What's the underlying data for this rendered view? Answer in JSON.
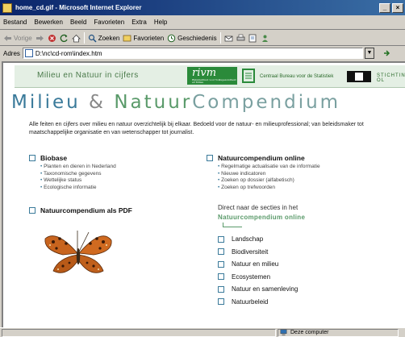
{
  "window": {
    "title": "home_cd.gif - Microsoft Internet Explorer",
    "minimize": "_",
    "close": "×"
  },
  "menu": [
    "Bestand",
    "Bewerken",
    "Beeld",
    "Favorieten",
    "Extra",
    "Help"
  ],
  "toolbar": {
    "back": "Vorige",
    "search": "Zoeken",
    "favorites": "Favorieten",
    "history": "Geschiedenis"
  },
  "address": {
    "label": "Adres",
    "value": "D:\\nc\\cd-rom\\index.htm"
  },
  "page": {
    "tagline": "Milieu en Natuur in cijfers",
    "rivm": "rivm",
    "rivm_small": "Rijksinstituut voor Volksgezondheid en Milieu",
    "cbs": "Centraal Bureau voor de Statistiek",
    "stichting": "STICHTING OL",
    "title_part1": "Milieu",
    "title_amp": " & ",
    "title_part2": "Natuur",
    "title_part3": "Compendium",
    "intro": "Alle feiten en cijfers over milieu en natuur overzichtelijk bij elkaar. Bedoeld voor de natuur- en milieuprofessional; van beleidsmaker tot maatschappelijke organisatie en van wetenschapper tot journalist.",
    "biobase": {
      "title": "Biobase",
      "items": [
        "Planten en dieren in Nederland",
        "Taxonomische gegevens",
        "Wettelijke status",
        "Ecologische informatie"
      ]
    },
    "online": {
      "title": "Natuurcompendium online",
      "items": [
        "Regelmatige actualisatie van de informatie",
        "Nieuwe indicatoren",
        "Zoeken op dossier (alfabetisch)",
        "Zoeken op trefwoorden"
      ]
    },
    "pdf_title": "Natuurcompendium als PDF",
    "direct_title": "Direct naar de secties in het",
    "direct_sub": "Natuurcompendium online",
    "sections": [
      "Landschap",
      "Biodiversiteit",
      "Natuur en milieu",
      "Ecosystemen",
      "Natuur en samenleving",
      "Natuurbeleid"
    ]
  },
  "status": {
    "zone": "Deze computer"
  },
  "colors": {
    "accent_blue": "#3a7a9a",
    "accent_green": "#5a9a6a",
    "rivm_green": "#2a8a3a"
  }
}
